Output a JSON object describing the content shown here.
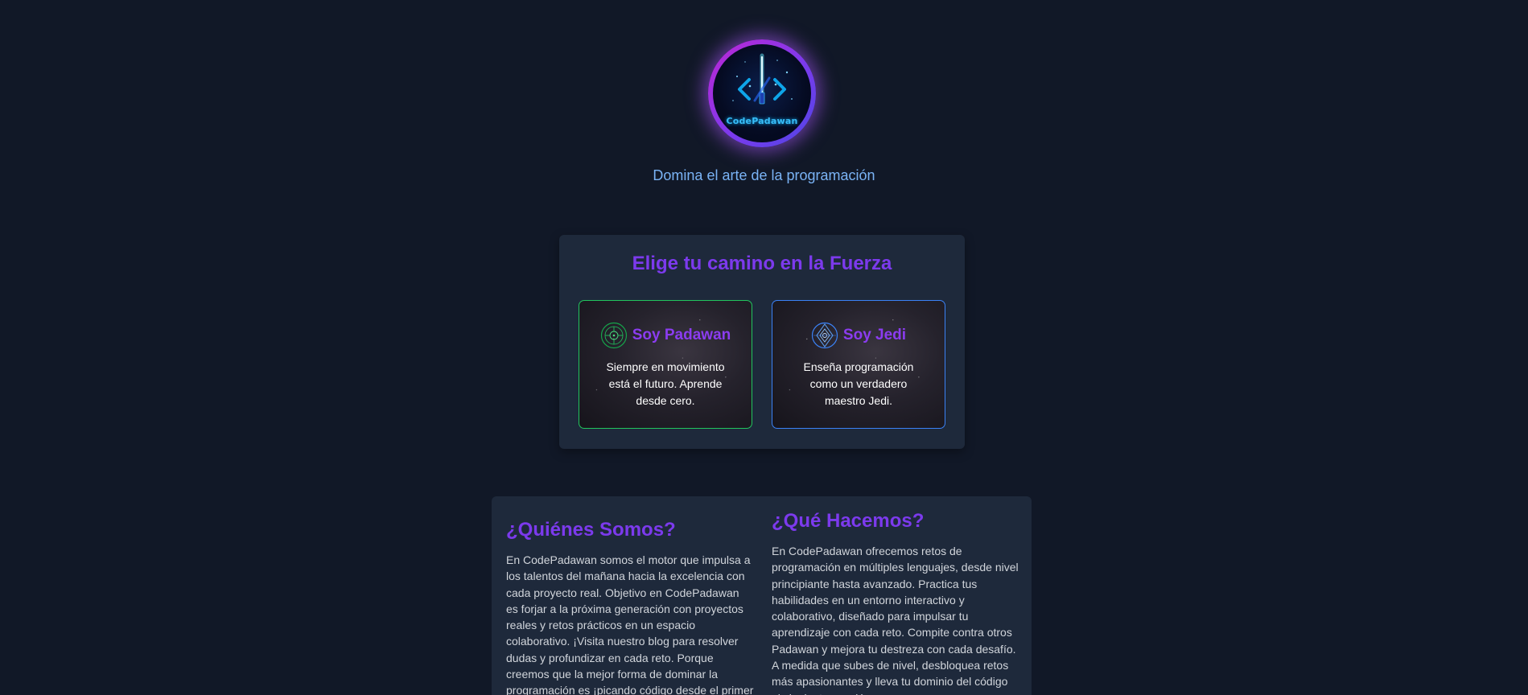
{
  "brand": {
    "logo_text": "CodePadawan",
    "tagline": "Domina el arte de la programación"
  },
  "path_selector": {
    "title": "Elige tu camino en la Fuerza",
    "cards": [
      {
        "name": "Soy Padawan",
        "description": "Siempre en movimiento está el futuro. Aprende desde cero.",
        "icon": "padawan-emblem-icon",
        "border_color": "#22c55e"
      },
      {
        "name": "Soy Jedi",
        "description": "Enseña programación como un verdadero maestro Jedi.",
        "icon": "jedi-emblem-icon",
        "border_color": "#3b82f6"
      }
    ]
  },
  "about": {
    "title": "¿Quiénes Somos?",
    "text": "En CodePadawan somos el motor que impulsa a los talentos del mañana hacia la excelencia con cada proyecto real. Objetivo en CodePadawan es forjar a la próxima generación con proyectos reales y retos prácticos en un espacio colaborativo. ¡Visita nuestro blog para resolver dudas y profundizar en cada reto. Porque creemos que la mejor forma de dominar la programación es ¡picando código desde el primer"
  },
  "what_we_do": {
    "title": "¿Qué Hacemos?",
    "text": "En CodePadawan ofrecemos retos de programación en múltiples lenguajes, desde nivel principiante hasta avanzado. Practica tus habilidades en un entorno interactivo y colaborativo, diseñado para impulsar tu aprendizaje con cada reto. Compite contra otros Padawan y mejora tu destreza con cada desafío. A medida que subes de nivel, desbloquea retos más apasionantes y lleva tu dominio del código al siguiente escalón."
  },
  "colors": {
    "background": "#111827",
    "panel": "#1e293b",
    "accent_purple": "#7c3aed",
    "tagline_blue": "#7ab3f5"
  }
}
